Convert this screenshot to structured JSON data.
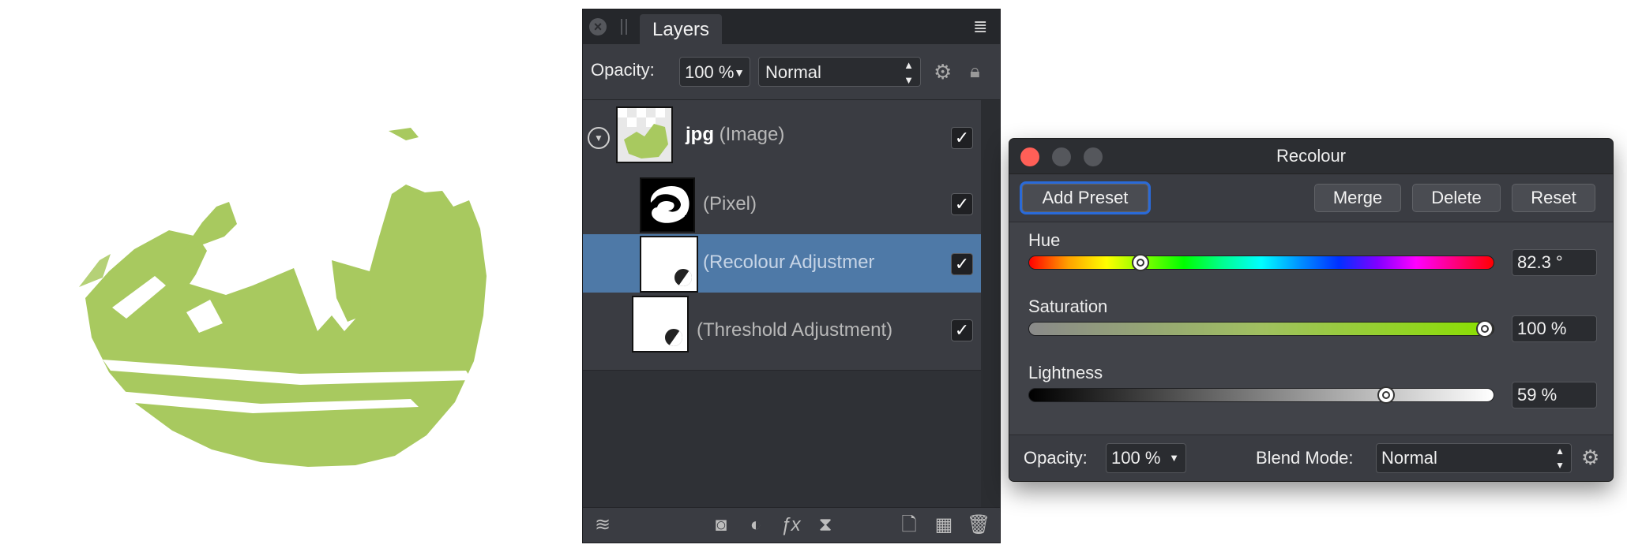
{
  "layers_panel": {
    "tab_label": "Layers",
    "opacity_label": "Opacity:",
    "opacity_value": "100 %",
    "blend_mode": "Normal",
    "layers": [
      {
        "name": "jpg",
        "type": "(Image)",
        "visible": true
      },
      {
        "name": "",
        "type": "(Pixel)",
        "visible": true
      },
      {
        "name": "",
        "type": "(Recolour Adjustmer",
        "visible": true,
        "selected": true
      },
      {
        "name": "",
        "type": "(Threshold Adjustment)",
        "visible": true
      }
    ],
    "check_glyph": "✓"
  },
  "recolour_dialog": {
    "title": "Recolour",
    "buttons": {
      "add_preset": "Add Preset",
      "merge": "Merge",
      "delete": "Delete",
      "reset": "Reset"
    },
    "sliders": {
      "hue": {
        "label": "Hue",
        "value": "82.3 °",
        "fraction": 0.229
      },
      "saturation": {
        "label": "Saturation",
        "value": "100 %",
        "fraction": 1.0
      },
      "lightness": {
        "label": "Lightness",
        "value": "59 %",
        "fraction": 0.78
      }
    },
    "footer": {
      "opacity_label": "Opacity:",
      "opacity_value": "100 %",
      "blend_label": "Blend Mode:",
      "blend_value": "Normal"
    }
  },
  "colors": {
    "recolour_green": "#a8c95f",
    "selected_row": "#4e79a7",
    "close_red": "#ff5f57",
    "focus_ring": "#2a6ad8"
  }
}
